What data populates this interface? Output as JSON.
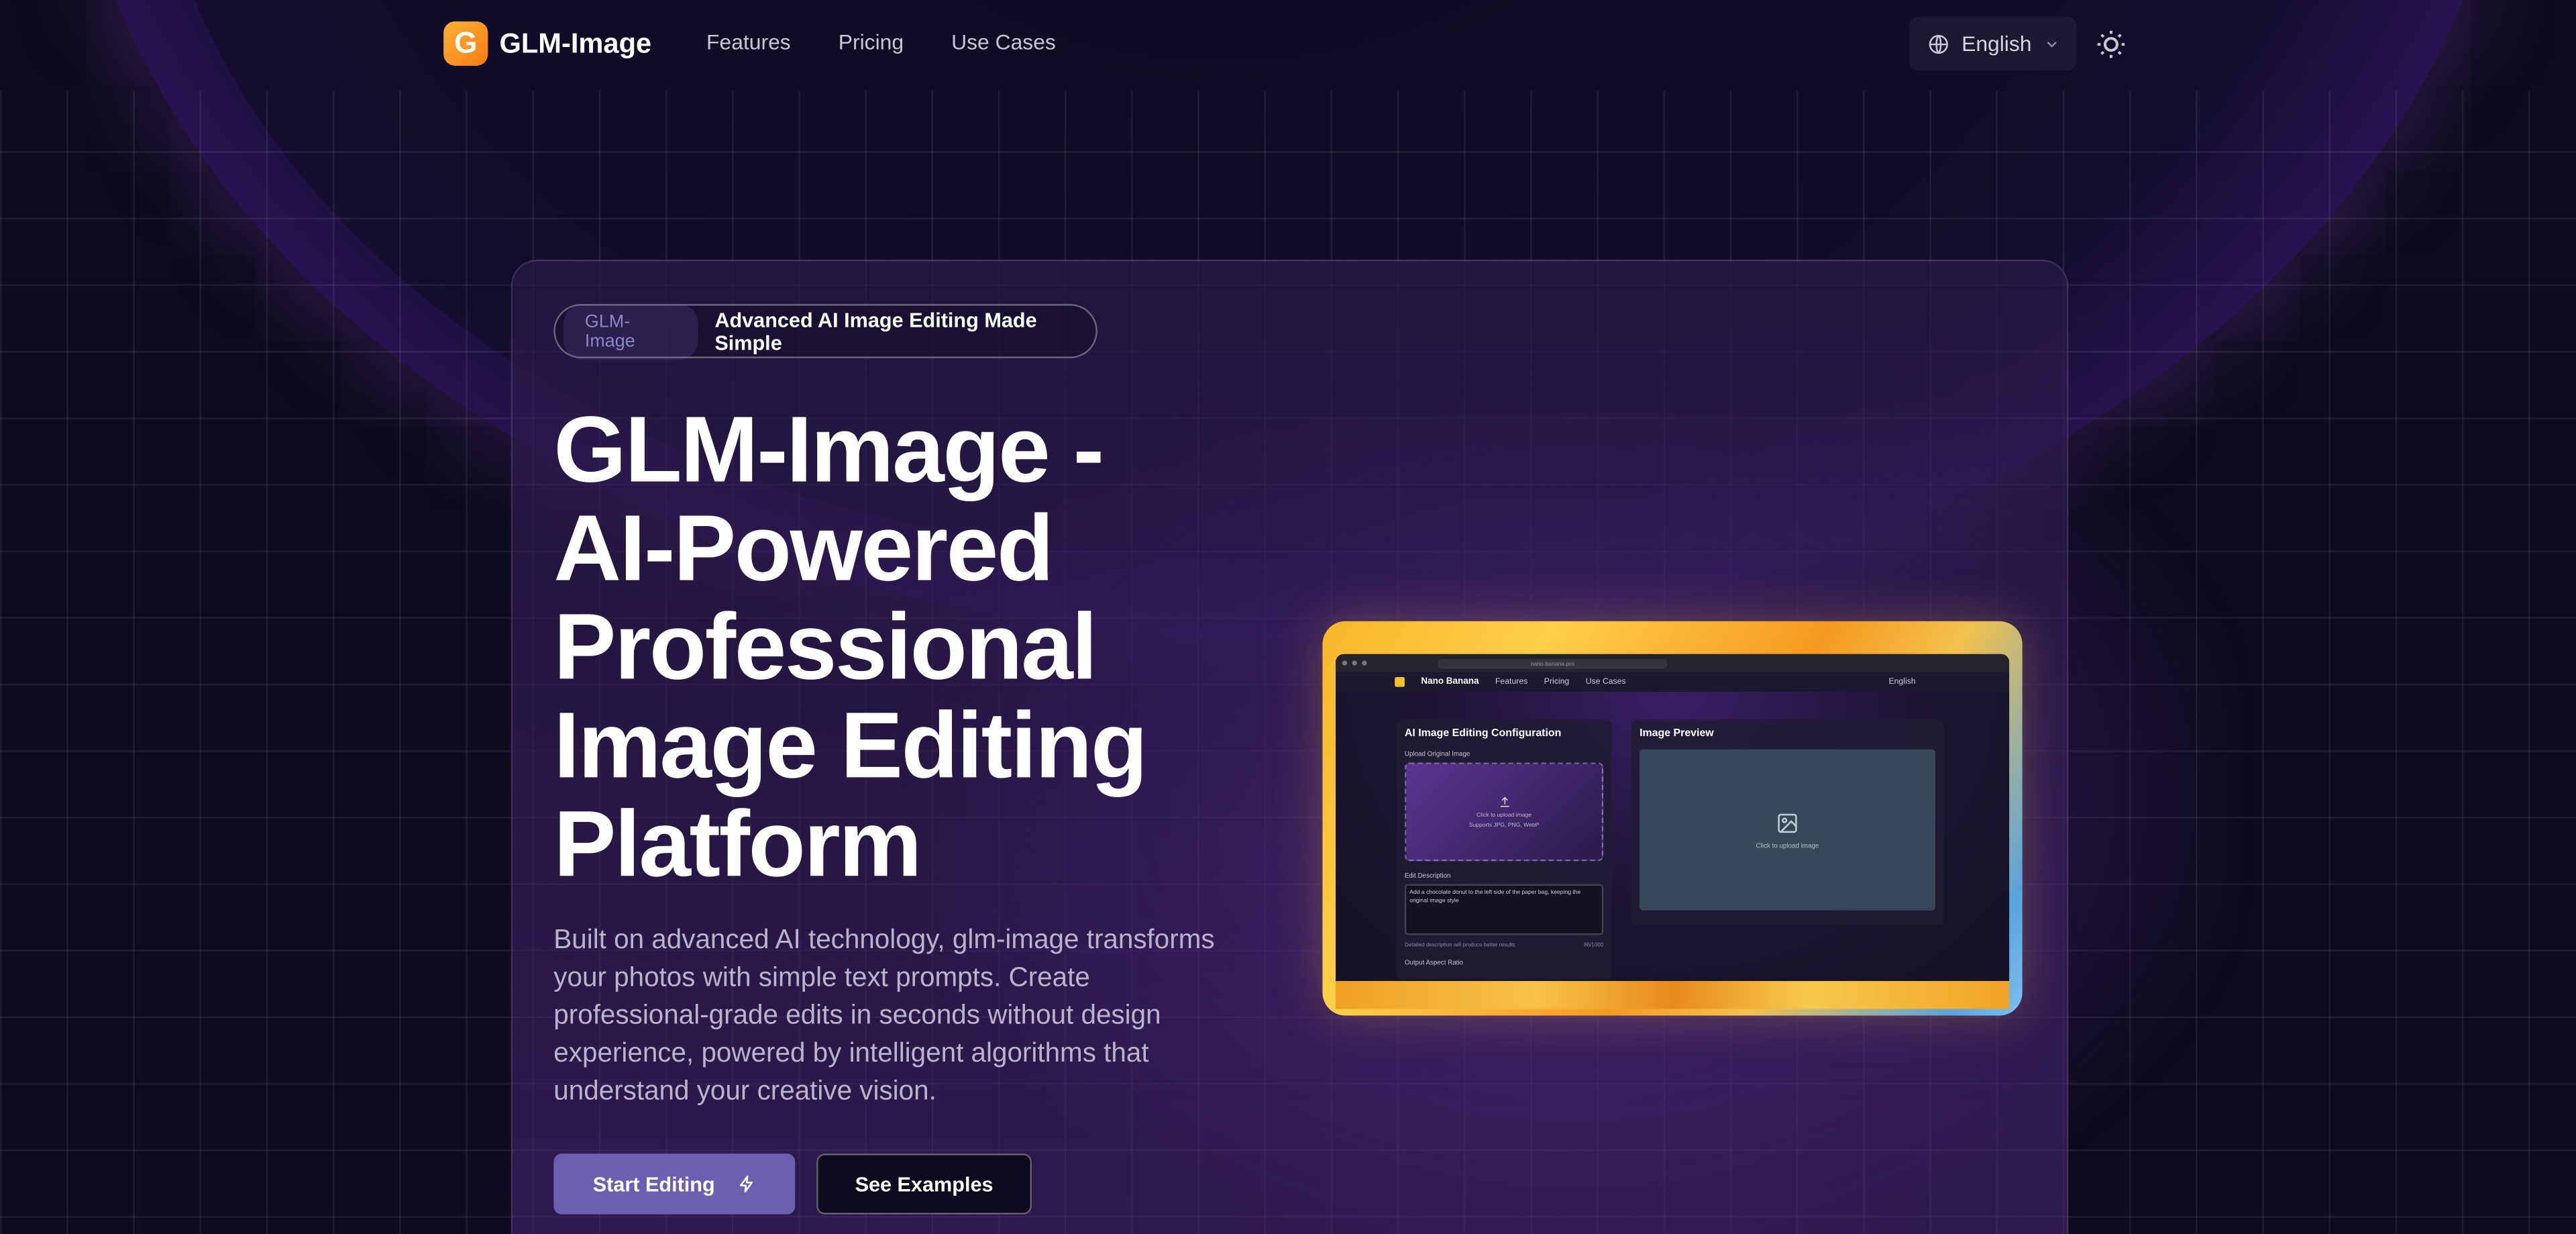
{
  "nav": {
    "logo_letter": "G",
    "brand": "GLM-Image",
    "links": [
      "Features",
      "Pricing",
      "Use Cases"
    ],
    "language": "English"
  },
  "hero": {
    "badge_tag": "GLM-Image",
    "badge_text": "Advanced AI Image Editing Made Simple",
    "title_lines": [
      "GLM-Image -",
      "AI-Powered",
      "Professional",
      "Image Editing",
      "Platform"
    ],
    "description": "Built on advanced AI technology, glm-image transforms your photos with simple text prompts. Create professional-grade edits in seconds without design experience, powered by intelligent algorithms that understand your creative vision.",
    "primary_button": "Start Editing",
    "secondary_button": "See Examples"
  },
  "preview": {
    "url": "nano-banana.pro",
    "brand": "Nano Banana",
    "nav_links": [
      "Features",
      "Pricing",
      "Use Cases"
    ],
    "language": "English",
    "config_title": "AI Image Editing Configuration",
    "upload_label": "Upload Original Image",
    "upload_hint": "Click to upload image",
    "upload_formats": "Supports JPG, PNG, WebP",
    "edit_label": "Edit Description",
    "edit_text": "Add a chocolate donut to the left side of the paper bag, keeping the original image style",
    "edit_hint": "Detailed description will produce better results",
    "char_count": "86/1000",
    "aspect_label": "Output Aspect Ratio",
    "preview_title": "Image Preview",
    "preview_hint": "Click to upload image"
  },
  "colors": {
    "background": "#0d0b1d",
    "primary_button": "#6b5fb0",
    "logo_orange": "#f57c12"
  }
}
